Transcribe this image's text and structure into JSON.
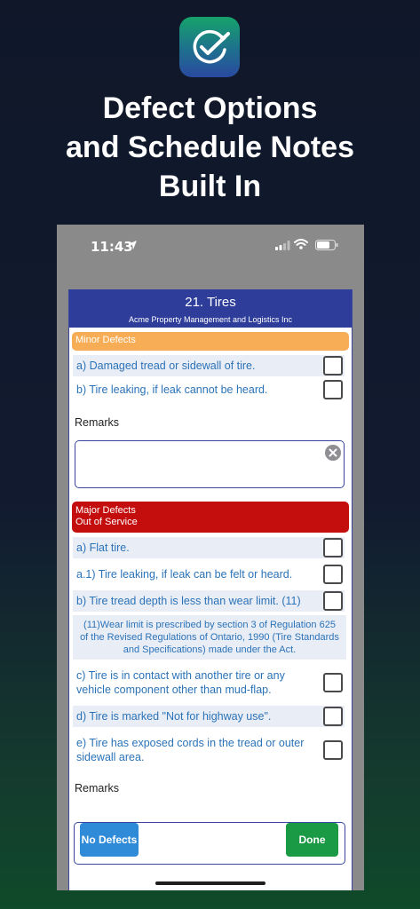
{
  "promo": {
    "headline_line1": "Defect Options",
    "headline_line2": "and Schedule Notes",
    "headline_line3": "Built In"
  },
  "status_bar": {
    "time": "11:43"
  },
  "sheet": {
    "title": "21. Tires",
    "subtitle": "Acme Property Management and Logistics Inc",
    "minor": {
      "label": "Minor Defects",
      "items": [
        {
          "text": "a) Damaged tread or sidewall of tire."
        },
        {
          "text": "b) Tire leaking, if leak cannot be heard."
        }
      ]
    },
    "remarks_label": "Remarks",
    "major": {
      "label_line1": "Major Defects",
      "label_line2": "Out of Service",
      "items": [
        {
          "text": "a) Flat tire."
        },
        {
          "text": "a.1) Tire leaking, if leak can be felt or heard."
        },
        {
          "text": "b) Tire tread depth is less than wear limit. (11)"
        },
        {
          "text": "c) Tire is in contact with another tire or any vehicle component other than mud-flap."
        },
        {
          "text": "d) Tire is marked \"Not for highway use\"."
        },
        {
          "text": "e) Tire has exposed cords in the tread or outer sidewall area."
        }
      ],
      "note": "(11)Wear limit is prescribed by section 3 of Regulation 625 of the Revised Regulations of Ontario, 1990 (Tire Standards and Specifications) made under the Act."
    },
    "remarks_label_2": "Remarks"
  },
  "buttons": {
    "no_defects": "No Defects",
    "done": "Done"
  },
  "colors": {
    "header": "#2e3d9a",
    "minor": "#f6ad55",
    "major": "#c40d0d",
    "item_text": "#2b73b8",
    "no_defects_button": "#2f8ad8",
    "done_button": "#1a9a45"
  }
}
